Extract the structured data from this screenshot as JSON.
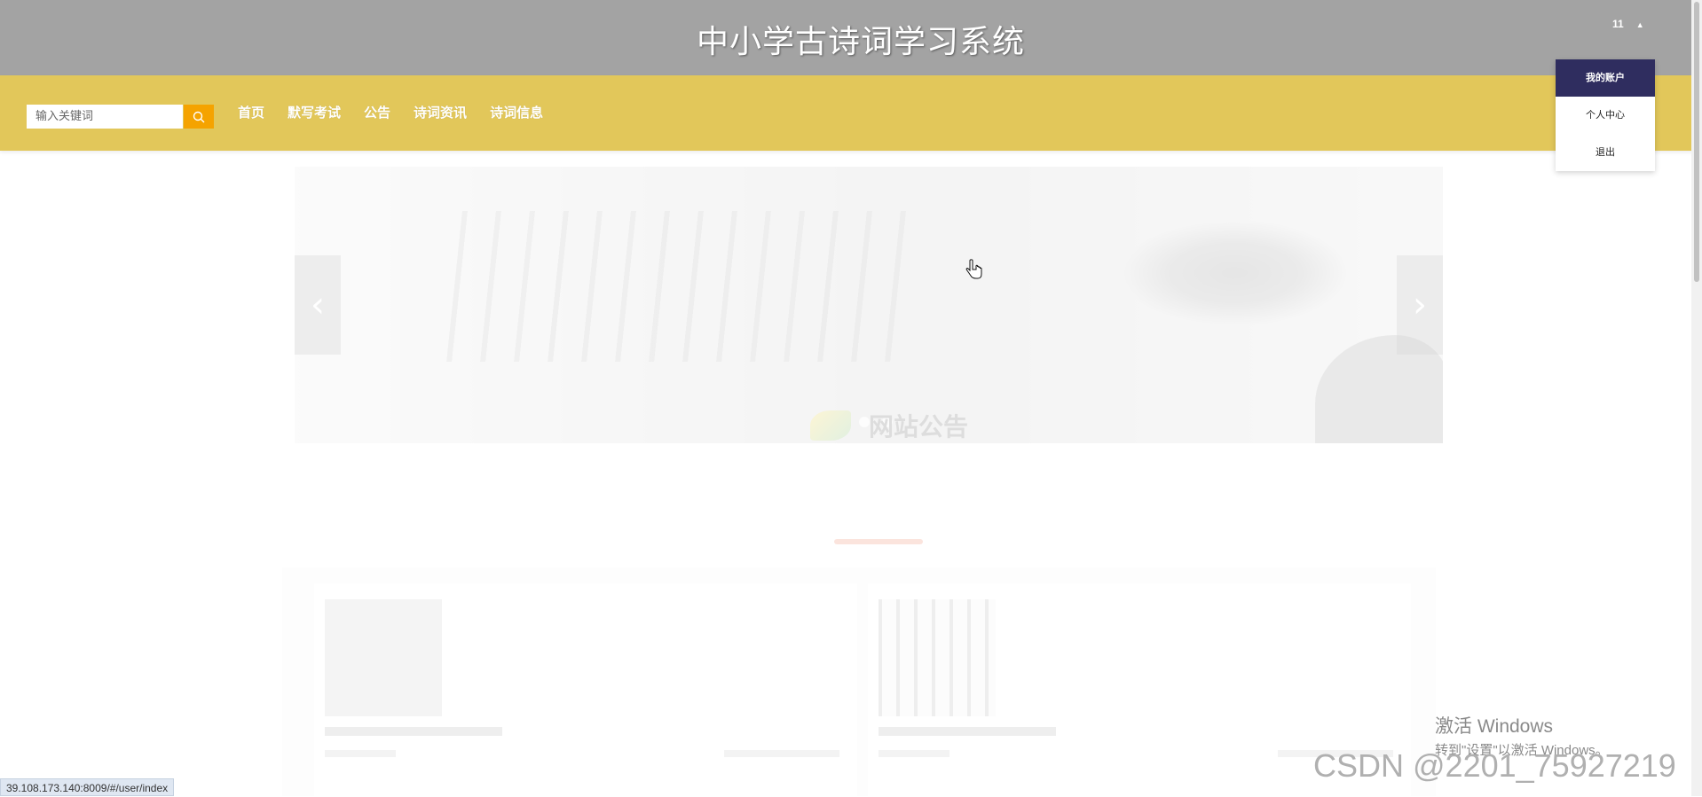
{
  "header": {
    "site_title": "中小学古诗词学习系统",
    "user_label": "11",
    "user_caret": "▲"
  },
  "navbar": {
    "search_placeholder": "输入关键词",
    "links": [
      "首页",
      "默写考试",
      "公告",
      "诗词资讯",
      "诗词信息"
    ]
  },
  "user_dropdown": {
    "items": [
      "我的账户",
      "个人中心",
      "退出"
    ],
    "active_index": 0
  },
  "banner": {
    "prev_arrow": "‹",
    "next_arrow": "›"
  },
  "notice_section": {
    "title": "网站公告"
  },
  "status_bar": {
    "url": "39.108.173.140:8009/#/user/index"
  },
  "windows_activation": {
    "title": "激活 Windows",
    "subtitle": "转到\"设置\"以激活 Windows。"
  },
  "watermark": "CSDN @2201_75927219",
  "colors": {
    "topbar": "#a3a3a3",
    "navbar": "#e2c75a",
    "search_button": "#f5a300",
    "dropdown_active": "#2f2d5f"
  }
}
